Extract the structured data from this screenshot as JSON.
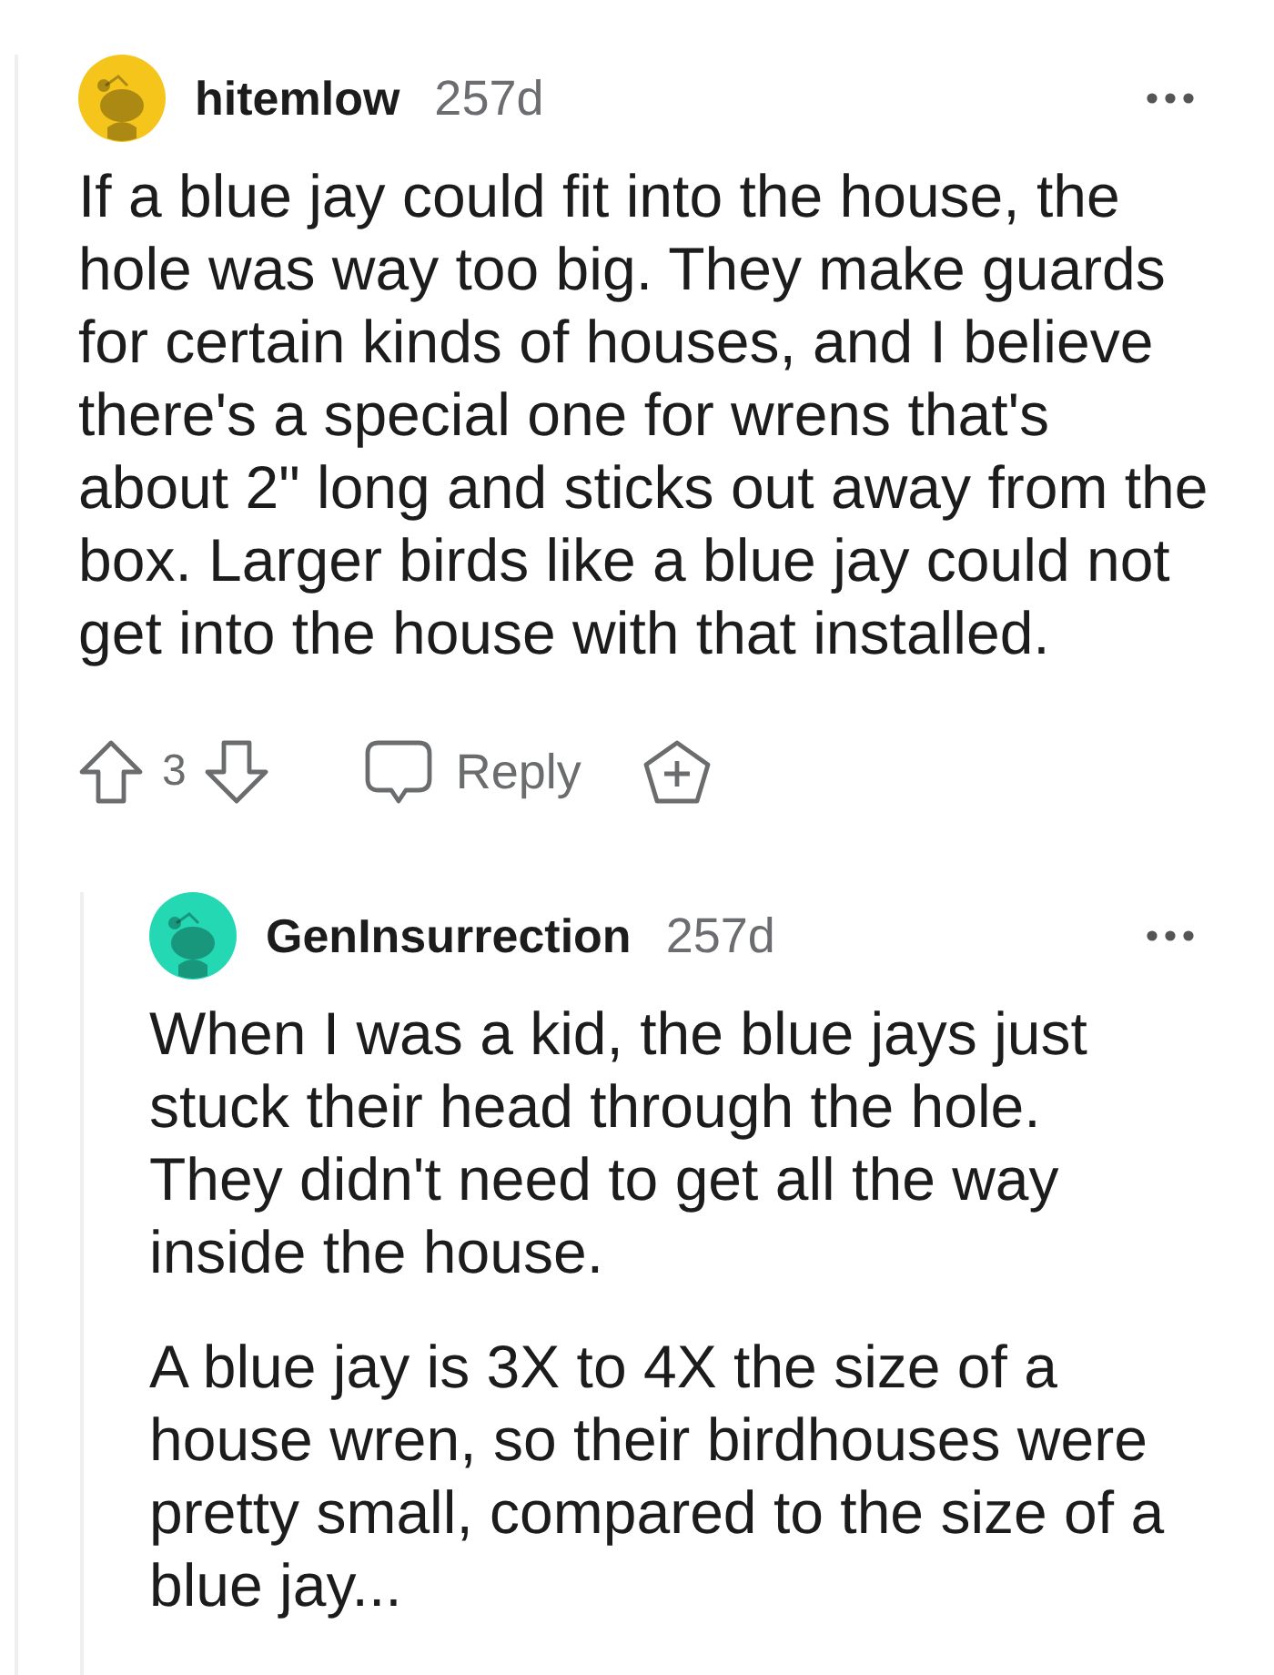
{
  "comments": [
    {
      "author": "hitemlow",
      "age": "257d",
      "color": "#f5c51c",
      "paragraphs": [
        "If a blue jay could fit into the house, the hole was way too big. They make guards for certain kinds of houses, and I believe there's a special one for wrens that's about 2\" long and sticks out away from the box. Larger birds like a blue jay could not get into the house with that installed."
      ],
      "actions": {
        "votes": "3",
        "reply": "Reply"
      },
      "replies": [
        {
          "author": "GenInsurrection",
          "age": "257d",
          "color": "#24d8b4",
          "paragraphs": [
            "When I was a kid, the blue jays just stuck their head through the hole. They didn't need to get all the way inside the house.",
            "A blue jay is 3X to 4X the size of a house wren, so their birdhouses were pretty small, compared to the size of a blue jay..."
          ]
        }
      ]
    }
  ]
}
